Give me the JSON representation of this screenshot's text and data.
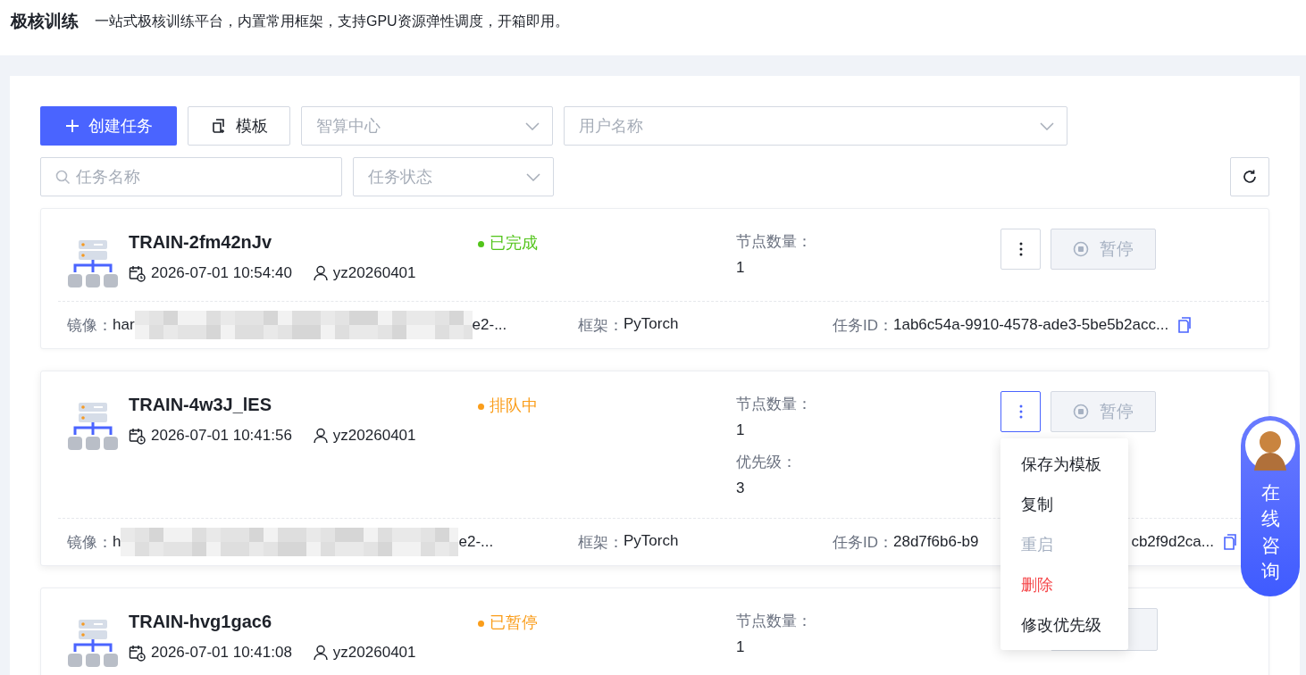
{
  "header": {
    "title": "极核训练",
    "description": "一站式极核训练平台，内置常用框架，支持GPU资源弹性调度，开箱即用。"
  },
  "toolbar": {
    "create_button": "创建任务",
    "template_button": "模板",
    "filters": [
      {
        "kind": "select",
        "placeholder": "智算中心"
      },
      {
        "kind": "select",
        "placeholder": "用户名称"
      },
      {
        "kind": "search",
        "placeholder": "任务名称"
      },
      {
        "kind": "select",
        "placeholder": "任务状态"
      }
    ]
  },
  "tasks": [
    {
      "name": "TRAIN-2fm42nJv",
      "created": "2026-07-01 10:54:40",
      "user": "yz20260401",
      "status": {
        "label": "已完成",
        "color": "#52c41a"
      },
      "info": [
        {
          "label": "节点数量：",
          "value": "1"
        }
      ],
      "more_button": true,
      "menu_open": false,
      "pause_label": "暂停",
      "image_label": "镜像：",
      "image_prefix": "har",
      "image_suffix": "e2-...",
      "framework_label": "框架：",
      "framework": "PyTorch",
      "task_id_label": "任务ID：",
      "task_id": [
        "1ab6c54a-9910-4578-ade3-5be5b2acc..."
      ]
    },
    {
      "name": "TRAIN-4w3J_lES",
      "created": "2026-07-01 10:41:56",
      "user": "yz20260401",
      "status": {
        "label": "排队中",
        "color": "#fa9d1a"
      },
      "info": [
        {
          "label": "节点数量：",
          "value": "1"
        },
        {
          "label": "优先级：",
          "value": "3"
        }
      ],
      "more_button": true,
      "menu_open": true,
      "pause_label": "暂停",
      "image_label": "镜像：",
      "image_prefix": "h",
      "image_suffix": "e2-...",
      "framework_label": "框架：",
      "framework": "PyTorch",
      "task_id_label": "任务ID：",
      "task_id": [
        "28d7f6b6-b9",
        "cb2f9d2ca..."
      ]
    },
    {
      "name": "TRAIN-hvg1gac6",
      "created": "2026-07-01 10:41:08",
      "user": "yz20260401",
      "status": {
        "label": "已暂停",
        "color": "#fa9d1a"
      },
      "info": [
        {
          "label": "节点数量：",
          "value": "1"
        }
      ],
      "more_button": false
    }
  ],
  "action_menu": {
    "items": [
      {
        "label": "保存为模板",
        "kind": "normal"
      },
      {
        "label": "复制",
        "kind": "normal"
      },
      {
        "label": "重启",
        "kind": "disabled"
      },
      {
        "label": "删除",
        "kind": "danger"
      },
      {
        "label": "修改优先级",
        "kind": "normal"
      }
    ]
  },
  "chat_widget": {
    "label": "在线咨询"
  }
}
